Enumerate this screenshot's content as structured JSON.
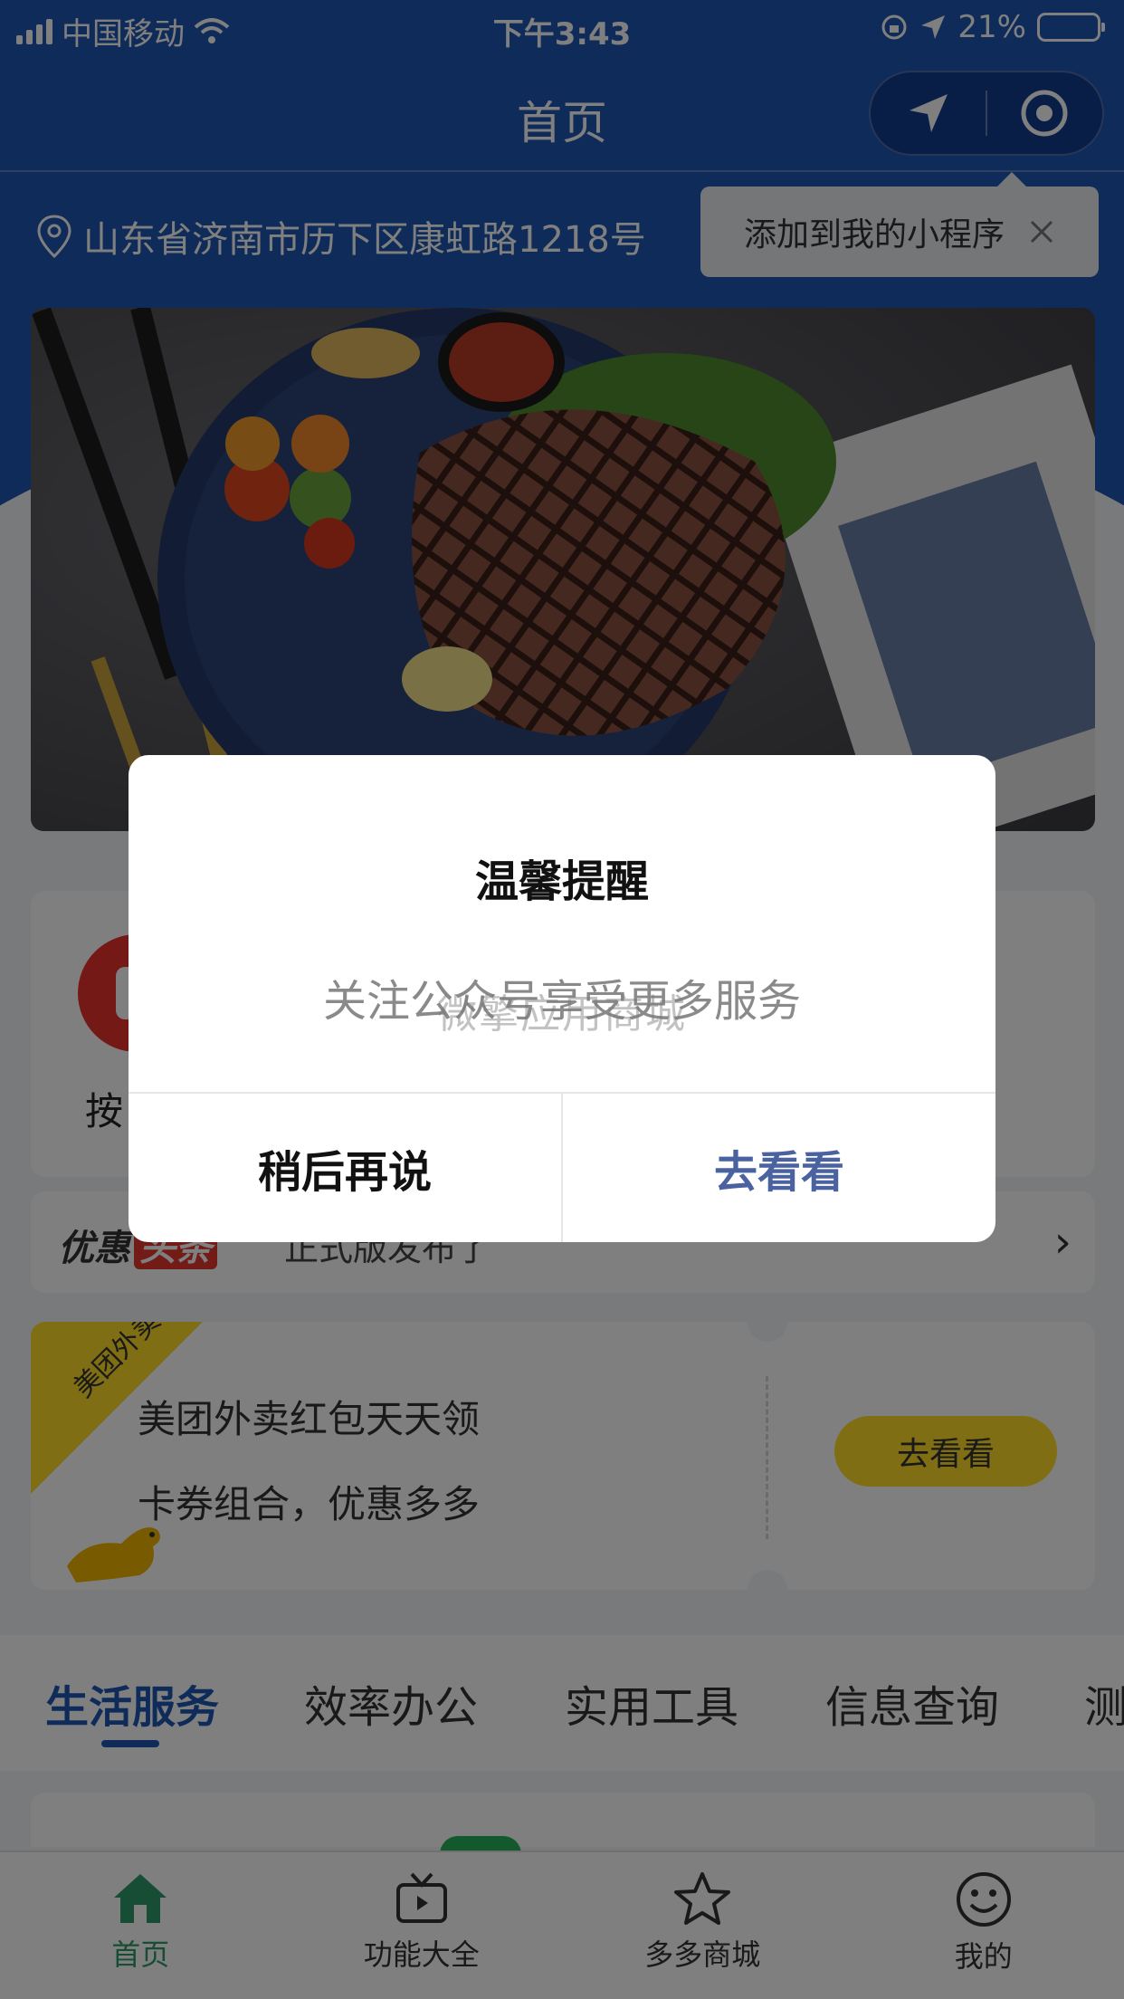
{
  "status_bar": {
    "carrier": "中国移动",
    "time": "下午3:43",
    "battery": "21%",
    "battery_level": 0.21
  },
  "navbar": {
    "title": "首页"
  },
  "location": {
    "address": "山东省济南市历下区康虹路1218号"
  },
  "add_tip": {
    "text": "添加到我的小程序"
  },
  "icon_grid": {
    "first_label": "按"
  },
  "news": {
    "logo_a": "优惠",
    "logo_b": "头条",
    "text": "正式版发布了"
  },
  "coupon": {
    "ribbon": "美团外卖",
    "title": "美团外卖红包天天领",
    "subtitle": "卡券组合，优惠多多",
    "button": "去看看"
  },
  "tabs": [
    {
      "label": "生活服务",
      "active": true
    },
    {
      "label": "效率办公"
    },
    {
      "label": "实用工具"
    },
    {
      "label": "信息查询"
    },
    {
      "label": "测"
    }
  ],
  "tabbar": [
    {
      "label": "首页",
      "icon": "home-icon",
      "active": true
    },
    {
      "label": "功能大全",
      "icon": "tv-icon"
    },
    {
      "label": "多多商城",
      "icon": "star-icon"
    },
    {
      "label": "我的",
      "icon": "smile-icon"
    }
  ],
  "dialog": {
    "title": "温馨提醒",
    "message": "关注公众号享受更多服务",
    "watermark": "微擎应用商城",
    "cancel": "稍后再说",
    "confirm": "去看看"
  },
  "colors": {
    "brand_blue": "#1f56b3",
    "tab_active_green": "#2e9a6b",
    "coupon_yellow": "#ffdc28",
    "confirm_text": "#4a62a0"
  }
}
